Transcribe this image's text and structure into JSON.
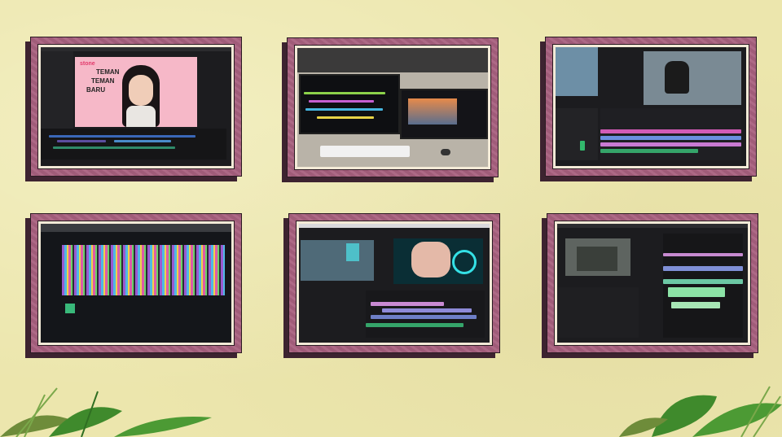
{
  "thumbnails": [
    {
      "name": "final-cut-interview",
      "overlay": {
        "brand": "stone",
        "line1": "TEMAN",
        "line2": "TEMAN",
        "line3": "BARU"
      }
    },
    {
      "name": "desk-dual-monitors"
    },
    {
      "name": "premiere-studio-recording"
    },
    {
      "name": "angled-monitor-timeline"
    },
    {
      "name": "premiere-neon-edit"
    },
    {
      "name": "premiere-multicam-edit"
    }
  ],
  "colors": {
    "background": "#ece6ad",
    "frame": "#a9617f",
    "frame_shadow": "#3d2330",
    "mat": "#f3ead7",
    "leaf": "#3f8a2c"
  }
}
